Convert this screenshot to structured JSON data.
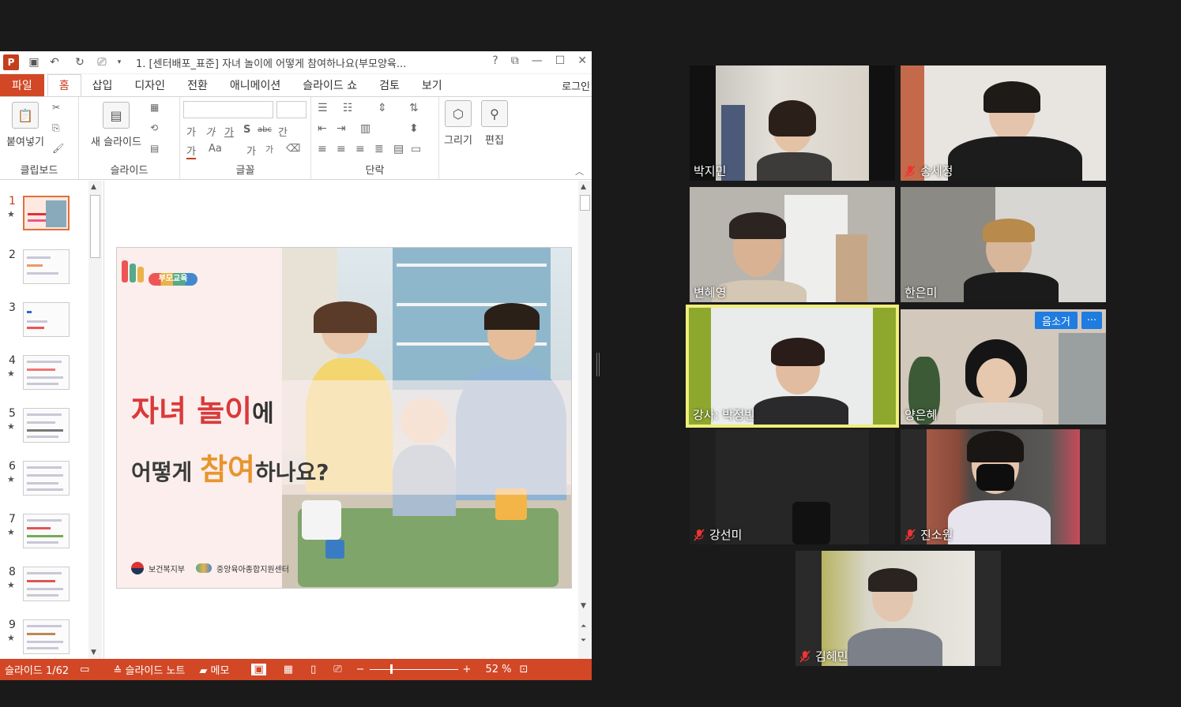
{
  "ppt": {
    "window_title": "1. [센터배포_표준] 자녀 놀이에 어떻게 참여하나요(부모양육...",
    "help": "?",
    "tabs": [
      "파일",
      "홈",
      "삽입",
      "디자인",
      "전환",
      "애니메이션",
      "슬라이드 쇼",
      "검토",
      "보기"
    ],
    "active_tab": "홈",
    "login": "로그인",
    "ribbon": {
      "paste": "붙여넣기",
      "new_slide": "새 슬라이드",
      "draw": "그리기",
      "edit": "편집",
      "groups": [
        "클립보드",
        "슬라이드",
        "글꼴",
        "단락"
      ],
      "font_buttons": [
        "가",
        "가",
        "가",
        "S",
        "abc",
        "간"
      ]
    },
    "thumbnails": [
      "1",
      "2",
      "3",
      "4",
      "5",
      "6",
      "7",
      "8",
      "9"
    ],
    "selected_slide": 1,
    "slide": {
      "logo_text": "부모교육",
      "line1_red": "자녀 놀이",
      "line1_rest": "에",
      "line2_a": "어떻게 ",
      "line2_orange": "참여",
      "line2_b": "하나요?",
      "footer_left": "보건복지부",
      "footer_right": "중앙육아종합지원센터"
    },
    "status": {
      "slide_counter": "슬라이드 1/62",
      "notes": "슬라이드 노트",
      "memo": "메모",
      "zoom": "52 %"
    }
  },
  "participants": [
    {
      "name": "박지민",
      "muted": false
    },
    {
      "name": "송세정",
      "muted": true
    },
    {
      "name": "변혜영",
      "muted": false
    },
    {
      "name": "한은미",
      "muted": false
    },
    {
      "name": "강사: 박정빈",
      "muted": false
    },
    {
      "name": "양은혜",
      "muted": false
    },
    {
      "name": "강선미",
      "muted": true
    },
    {
      "name": "진소원",
      "muted": true
    },
    {
      "name": "김혜민",
      "muted": true
    }
  ],
  "tile_actions": {
    "mute_button": "음소거",
    "more_button": "···"
  },
  "colors": {
    "ppt_accent": "#d24726",
    "speaker_border": "#f0ee7a",
    "zoom_blue": "#1f7ce0"
  }
}
